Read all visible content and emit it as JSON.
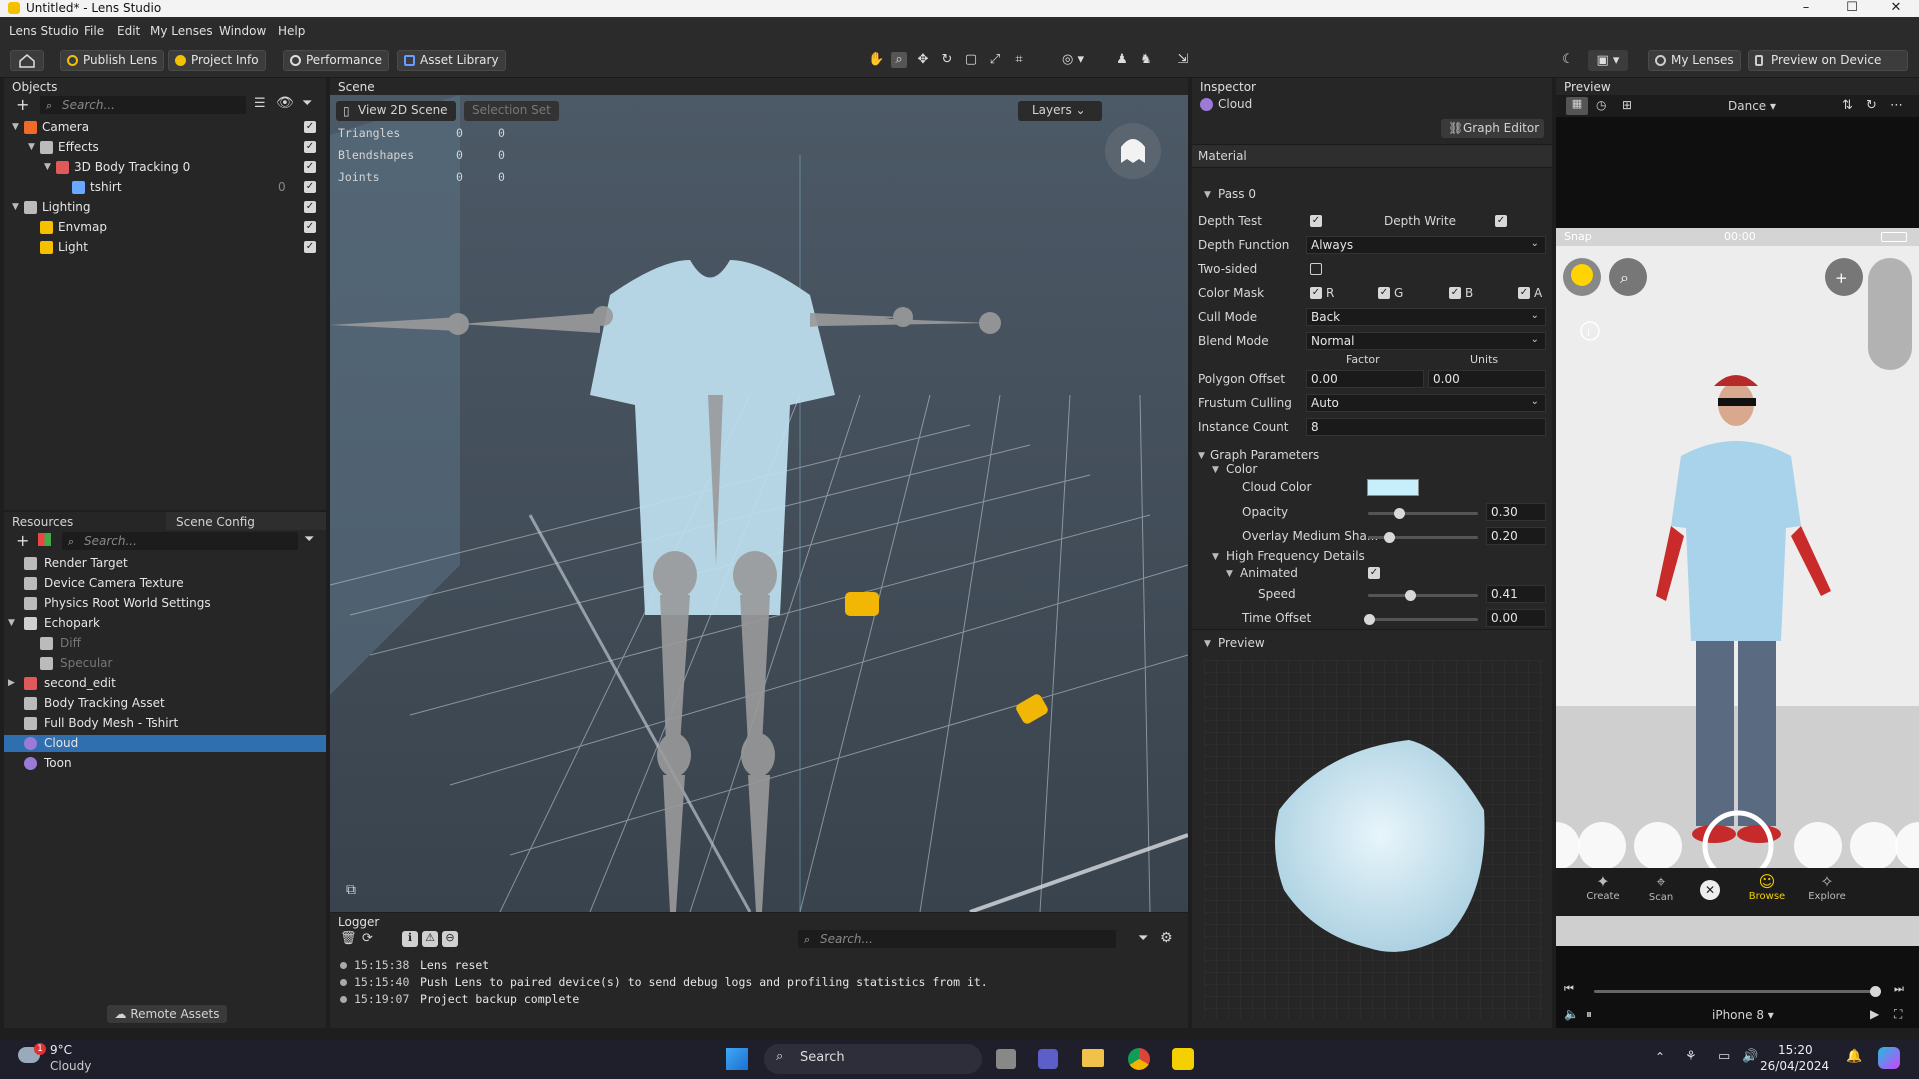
{
  "window": {
    "title": "Untitled* - Lens Studio",
    "controls": [
      "–",
      "☐",
      "✕"
    ]
  },
  "menu": [
    "Lens Studio",
    "File",
    "Edit",
    "My Lenses",
    "Window",
    "Help"
  ],
  "toolbar": {
    "publish": "Publish Lens",
    "project_info": "Project Info",
    "performance": "Performance",
    "asset_library": "Asset Library",
    "my_lenses": "My Lenses",
    "preview_on_device": "Preview on Device"
  },
  "objects": {
    "title": "Objects",
    "search_placeholder": "Search...",
    "items": [
      {
        "label": "Camera",
        "depth": 0,
        "expanded": true
      },
      {
        "label": "Effects",
        "depth": 1,
        "expanded": true
      },
      {
        "label": "3D Body Tracking 0",
        "depth": 2,
        "expanded": true
      },
      {
        "label": "tshirt",
        "depth": 3,
        "count": "0"
      },
      {
        "label": "Lighting",
        "depth": 0,
        "expanded": true
      },
      {
        "label": "Envmap",
        "depth": 1
      },
      {
        "label": "Light",
        "depth": 1
      }
    ]
  },
  "resources": {
    "tab1": "Resources",
    "tab2": "Scene Config",
    "search_placeholder": "Search...",
    "items": [
      {
        "label": "Render Target",
        "depth": 0,
        "dim": false
      },
      {
        "label": "Device Camera Texture",
        "depth": 0,
        "dim": false
      },
      {
        "label": "Physics Root World Settings",
        "depth": 0,
        "dim": false
      },
      {
        "label": "Echopark",
        "depth": 0,
        "dim": false,
        "folder": true
      },
      {
        "label": "Diff",
        "depth": 1,
        "dim": true
      },
      {
        "label": "Specular",
        "depth": 1,
        "dim": true
      },
      {
        "label": "second_edit",
        "depth": 0,
        "dim": false,
        "collapsed": true
      },
      {
        "label": "Body Tracking Asset",
        "depth": 0,
        "dim": false
      },
      {
        "label": "Full Body Mesh - Tshirt",
        "depth": 0,
        "dim": false
      },
      {
        "label": "Cloud",
        "depth": 0,
        "dim": false,
        "selected": true
      },
      {
        "label": "Toon",
        "depth": 0,
        "dim": false
      }
    ],
    "remote_assets": "Remote Assets"
  },
  "scene": {
    "title": "Scene",
    "view_2d": "View 2D Scene",
    "selection_set": "Selection Set",
    "layers": "Layers",
    "stats": [
      {
        "label": "Triangles",
        "a": "0",
        "b": "0"
      },
      {
        "label": "Blendshapes",
        "a": "0",
        "b": "0"
      },
      {
        "label": "Joints",
        "a": "0",
        "b": "0"
      }
    ]
  },
  "logger": {
    "title": "Logger",
    "search_placeholder": "Search...",
    "entries": [
      {
        "time": "15:15:38",
        "msg": "Lens reset"
      },
      {
        "time": "15:15:40",
        "msg": "Push Lens to paired device(s) to send debug logs and profiling statistics from it."
      },
      {
        "time": "15:19:07",
        "msg": "Project backup complete"
      }
    ]
  },
  "inspector": {
    "title": "Inspector",
    "object_name": "Cloud",
    "graph_editor": "Graph Editor",
    "material": "Material",
    "pass": "Pass 0",
    "depth_test": "Depth Test",
    "depth_write": "Depth Write",
    "depth_function": "Depth Function",
    "depth_function_value": "Always",
    "two_sided": "Two-sided",
    "color_mask": "Color Mask",
    "mask_r": "R",
    "mask_g": "G",
    "mask_b": "B",
    "mask_a": "A",
    "cull_mode": "Cull Mode",
    "cull_mode_value": "Back",
    "blend_mode": "Blend Mode",
    "blend_mode_value": "Normal",
    "factor": "Factor",
    "units": "Units",
    "polygon_offset": "Polygon Offset",
    "polygon_factor": "0.00",
    "polygon_units": "0.00",
    "frustum_culling": "Frustum Culling",
    "frustum_value": "Auto",
    "instance_count": "Instance Count",
    "instance_value": "8",
    "graph_parameters": "Graph Parameters",
    "color_group": "Color",
    "cloud_color": "Cloud Color",
    "cloud_color_hex": "#c6eefb",
    "opacity": "Opacity",
    "opacity_value": "0.30",
    "overlay": "Overlay Medium Sha...",
    "overlay_value": "0.20",
    "high_freq": "High Frequency Details",
    "animated": "Animated",
    "speed": "Speed",
    "speed_value": "0.41",
    "time_offset": "Time Offset",
    "time_offset_value": "0.00",
    "preview": "Preview"
  },
  "preview": {
    "title": "Preview",
    "dance": "Dance",
    "carrier": "Snap",
    "clock": "00:00",
    "nav": [
      "Create",
      "Scan",
      "Browse",
      "Explore"
    ],
    "device": "iPhone 8"
  },
  "taskbar": {
    "temp": "9°C",
    "weather": "Cloudy",
    "search": "Search",
    "time": "15:20",
    "date": "26/04/2024",
    "badge": "1"
  }
}
